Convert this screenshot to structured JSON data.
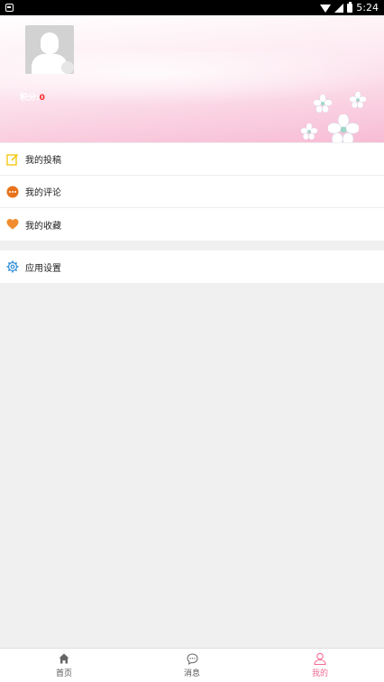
{
  "status_bar": {
    "time": "5:24"
  },
  "profile": {
    "points_label": "积分:",
    "points_value": "0"
  },
  "menu": {
    "group1": [
      {
        "label": "我的投稿",
        "icon": "edit-icon",
        "color": "#f5c400"
      },
      {
        "label": "我的评论",
        "icon": "comment-icon",
        "color": "#e8731a"
      },
      {
        "label": "我的收藏",
        "icon": "heart-icon",
        "color": "#f08c2e"
      }
    ],
    "group2": [
      {
        "label": "应用设置",
        "icon": "gear-icon",
        "color": "#2f8fd9"
      }
    ]
  },
  "bottom_nav": {
    "items": [
      {
        "label": "首页",
        "icon": "home-icon"
      },
      {
        "label": "消息",
        "icon": "message-icon"
      },
      {
        "label": "我的",
        "icon": "user-icon"
      }
    ],
    "active": "我的",
    "active_color": "#f36c94"
  }
}
